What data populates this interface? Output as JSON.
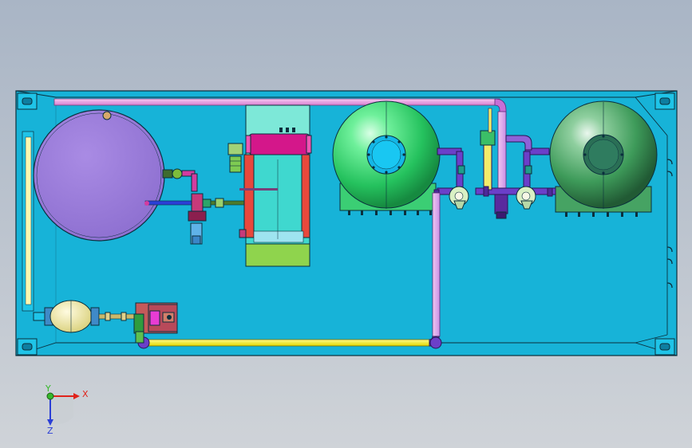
{
  "axis_triad": {
    "x_label": "X",
    "y_label": "Y",
    "z_label": "Z",
    "x_color": "#e0231b",
    "y_color": "#35b82a",
    "z_color": "#2b3fd6"
  },
  "colors": {
    "background_top": "#a9b5c5",
    "background_bottom": "#cfd3d8",
    "frame_fill": "#17b3d8",
    "frame_edge": "#0b2f3d",
    "tank_round_fill": "#9b7cd9",
    "pressure_vessel_left": "#31d46e",
    "pressure_vessel_right": "#3d9c5b",
    "pipe_pink": "#f0a0e8",
    "pipe_yellow": "#f6f10e",
    "pipe_purple": "#6b3fc9",
    "filter_cyan": "#5fe3d4",
    "filter_green": "#8fd44d",
    "filter_magenta": "#d4178a"
  }
}
